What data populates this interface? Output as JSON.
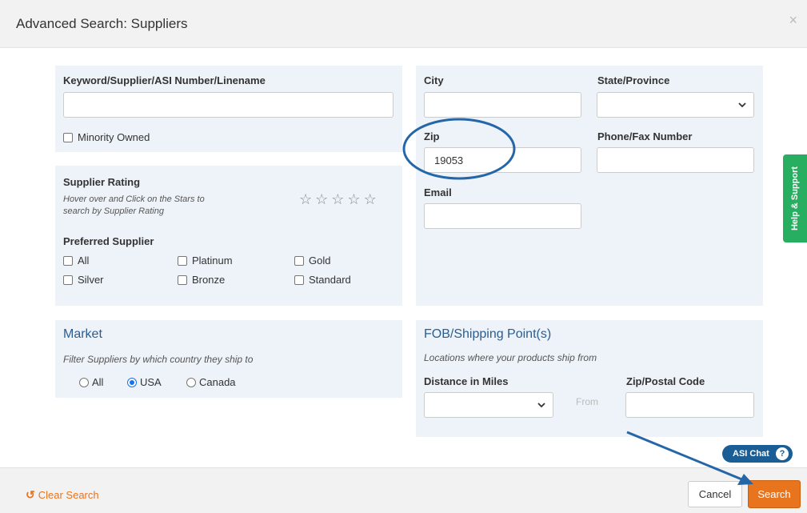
{
  "modal": {
    "title": "Advanced Search: Suppliers",
    "close_glyph": "×"
  },
  "keyword": {
    "label": "Keyword/Supplier/ASI Number/Linename",
    "value": "",
    "minority_owned": "Minority Owned"
  },
  "rating": {
    "label": "Supplier Rating",
    "hint_line1": "Hover over and Click on the Stars to",
    "hint_line2": "search by Supplier Rating",
    "star_glyph": "☆",
    "star_count": 5
  },
  "preferred": {
    "label": "Preferred Supplier",
    "options": [
      "All",
      "Platinum",
      "Gold",
      "Silver",
      "Bronze",
      "Standard"
    ]
  },
  "location": {
    "city_label": "City",
    "city_value": "",
    "state_label": "State/Province",
    "state_value": "",
    "zip_label": "Zip",
    "zip_value": "19053",
    "phone_label": "Phone/Fax Number",
    "phone_value": "",
    "email_label": "Email",
    "email_value": ""
  },
  "market": {
    "title": "Market",
    "hint": "Filter Suppliers by which country they ship to",
    "options": [
      "All",
      "USA",
      "Canada"
    ],
    "selected": "USA"
  },
  "fob": {
    "title": "FOB/Shipping Point(s)",
    "hint": "Locations where your products ship from",
    "distance_label": "Distance in Miles",
    "distance_value": "",
    "from_text": "From",
    "zip_label": "Zip/Postal Code",
    "zip_value": ""
  },
  "side_tab": {
    "label": "Help & Support"
  },
  "chat": {
    "label": "ASI Chat",
    "help_glyph": "?"
  },
  "footer": {
    "clear_label": "Clear Search",
    "clear_icon": "undo-icon",
    "cancel_label": "Cancel",
    "search_label": "Search"
  },
  "colors": {
    "accent_orange": "#e8741e",
    "panel_bg": "#eef3f9",
    "heading_blue": "#2b5d8f",
    "annotation_blue": "#2566a8",
    "help_green": "#27ae60",
    "chat_blue": "#1b5e96"
  }
}
